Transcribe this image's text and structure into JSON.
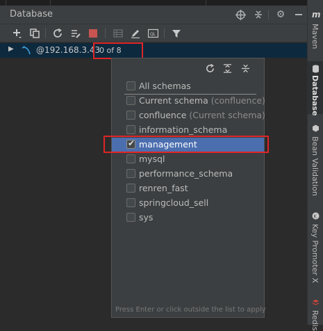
{
  "header": {
    "title": "Database"
  },
  "toolbar": {
    "icons": [
      "add-icon",
      "copy-icon",
      "refresh-icon",
      "properties-icon",
      "stop-icon",
      "table-icon",
      "edit-icon",
      "console-icon",
      "filter-icon"
    ]
  },
  "tree": {
    "connection_label": "@192.168.3.43",
    "schema_count": "0 of 8"
  },
  "schema_popup": {
    "all_schemas": "All schemas",
    "items": [
      {
        "label": "Current schema",
        "note": "(confluence)",
        "checked": false
      },
      {
        "label": "confluence",
        "note": "(Current schema)",
        "checked": false
      },
      {
        "label": "information_schema",
        "note": "",
        "checked": false
      },
      {
        "label": "management",
        "note": "",
        "checked": true
      },
      {
        "label": "mysql",
        "note": "",
        "checked": false
      },
      {
        "label": "performance_schema",
        "note": "",
        "checked": false
      },
      {
        "label": "renren_fast",
        "note": "",
        "checked": false
      },
      {
        "label": "springcloud_sell",
        "note": "",
        "checked": false
      },
      {
        "label": "sys",
        "note": "",
        "checked": false
      }
    ],
    "footer": "Press Enter or click outside the list to apply"
  },
  "rightbar": {
    "maven_icon": "m",
    "maven": "Maven",
    "database": "Database",
    "bean_validation": "Bean Validation",
    "key_promoter": "Key Promoter X",
    "redis": "Redis"
  },
  "colors": {
    "selection": "#4b6eaf",
    "annotation_red": "#e02525",
    "tree_row": "#0d293e"
  }
}
